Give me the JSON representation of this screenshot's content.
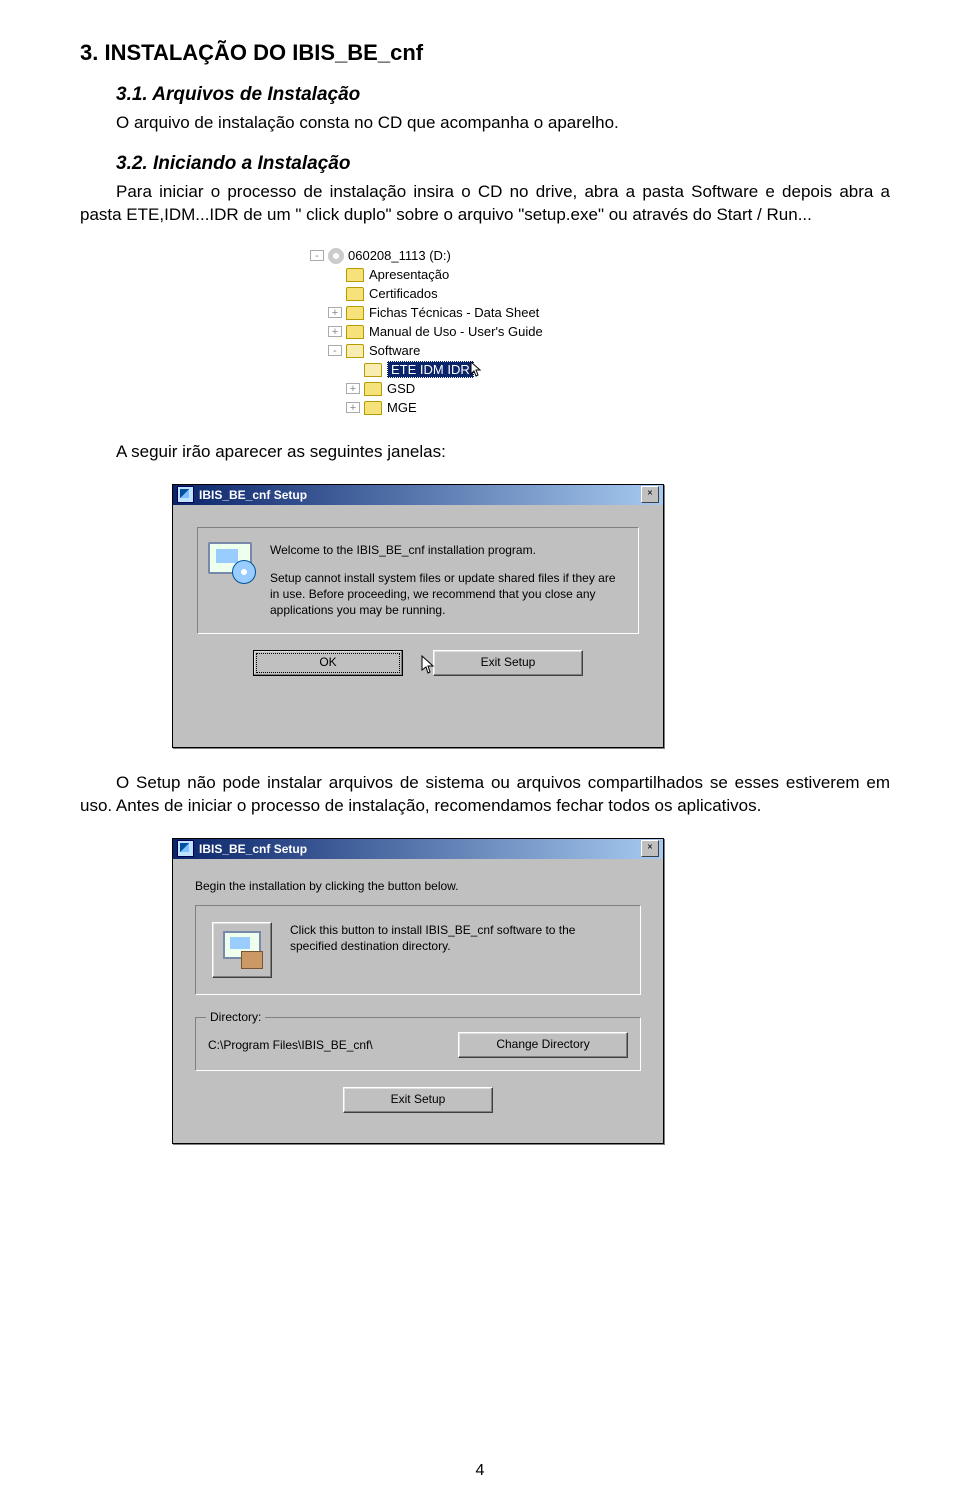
{
  "headings": {
    "h1": "3. INSTALAÇÃO DO IBIS_BE_cnf",
    "h2a": "3.1.  Arquivos de Instalação",
    "h2b": "3.2.  Iniciando a Instalação"
  },
  "paragraphs": {
    "p1": "O arquivo de instalação consta no CD que acompanha o aparelho.",
    "p2": "Para iniciar o processo de instalação insira o CD no drive, abra a pasta Software e depois abra a pasta ETE,IDM...IDR de um \" click duplo\" sobre o arquivo \"setup.exe\" ou através do Start / Run...",
    "p3": "A seguir irão aparecer as seguintes janelas:",
    "p4": "O Setup não pode instalar arquivos de sistema ou arquivos compartilhados se esses estiverem em uso. Antes de iniciar o processo de instalação, recomendamos fechar todos os aplicativos."
  },
  "tree": {
    "drive": "060208_1113 (D:)",
    "items": [
      "Apresentação",
      "Certificados",
      "Fichas Técnicas - Data Sheet",
      "Manual de Uso - User's Guide",
      "Software"
    ],
    "sub": {
      "selected": "ETE IDM IDR",
      "others": [
        "GSD",
        "MGE"
      ]
    }
  },
  "dialog1": {
    "title": "IBIS_BE_cnf Setup",
    "close": "×",
    "line1": "Welcome to the IBIS_BE_cnf installation program.",
    "line2": "Setup cannot install system files or update shared files if they are in use. Before proceeding, we recommend that you close any applications you may be running.",
    "ok": "OK",
    "exit": "Exit Setup"
  },
  "dialog2": {
    "title": "IBIS_BE_cnf Setup",
    "close": "×",
    "top": "Begin the installation by clicking the button below.",
    "msg": "Click this button to install IBIS_BE_cnf software to the specified destination directory.",
    "dirlegend": "Directory:",
    "dirpath": "C:\\Program Files\\IBIS_BE_cnf\\",
    "change": "Change Directory",
    "exit": "Exit Setup"
  },
  "pagenum": "4"
}
